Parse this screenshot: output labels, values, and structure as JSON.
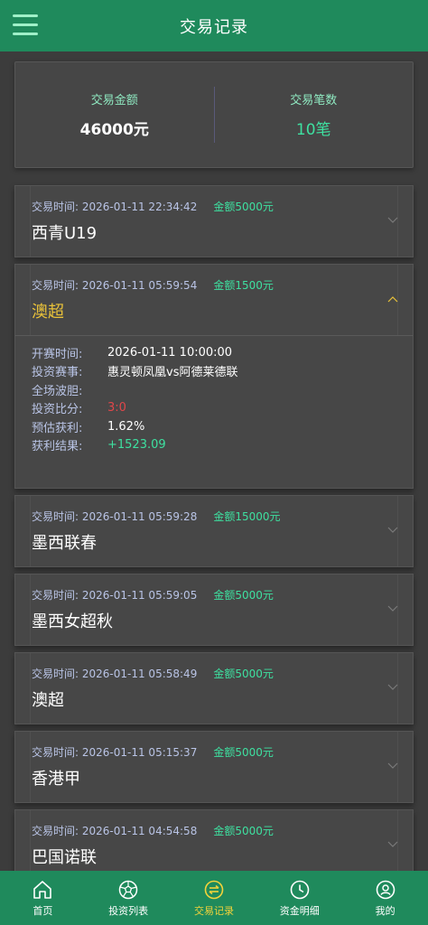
{
  "header": {
    "title": "交易记录"
  },
  "summary": {
    "amount_label": "交易金额",
    "amount_value": "46000元",
    "count_label": "交易笔数",
    "count_value": "10笔"
  },
  "records": [
    {
      "time_label": "交易时间:",
      "time": "2026-01-11 22:34:42",
      "amount": "金额5000元",
      "league": "西青U19"
    },
    {
      "time_label": "交易时间:",
      "time": "2026-01-11 05:59:54",
      "amount": "金额1500元",
      "league": "澳超",
      "details": {
        "start_label": "开赛时间:",
        "start": "2026-01-11 10:00:00",
        "match_label": "投资赛事:",
        "match": "惠灵顿凤凰vs阿德莱德联",
        "full_label": "全场波胆:",
        "score_label": "投资比分:",
        "score": "3:0",
        "profit_label": "预估获利:",
        "profit": "1.62%",
        "result_label": "获利结果:",
        "result": "+1523.09"
      }
    },
    {
      "time_label": "交易时间:",
      "time": "2026-01-11 05:59:28",
      "amount": "金额15000元",
      "league": "墨西联春"
    },
    {
      "time_label": "交易时间:",
      "time": "2026-01-11 05:59:05",
      "amount": "金额5000元",
      "league": "墨西女超秋"
    },
    {
      "time_label": "交易时间:",
      "time": "2026-01-11 05:58:49",
      "amount": "金额5000元",
      "league": "澳超"
    },
    {
      "time_label": "交易时间:",
      "time": "2026-01-11 05:15:37",
      "amount": "金额5000元",
      "league": "香港甲"
    },
    {
      "time_label": "交易时间:",
      "time": "2026-01-11 04:54:58",
      "amount": "金额5000元",
      "league": "巴国诺联"
    }
  ],
  "tabbar": {
    "items": [
      {
        "label": "首页",
        "icon": "home-icon"
      },
      {
        "label": "投资列表",
        "icon": "soccer-ball-icon"
      },
      {
        "label": "交易记录",
        "icon": "exchange-icon",
        "active": true
      },
      {
        "label": "资金明细",
        "icon": "clock-icon"
      },
      {
        "label": "我的",
        "icon": "user-icon"
      }
    ]
  },
  "colors": {
    "header_green": "#1f8a5c",
    "accent_green": "#3ee0a0",
    "highlight_yellow": "#e9c23a",
    "score_red": "#e0474a"
  }
}
